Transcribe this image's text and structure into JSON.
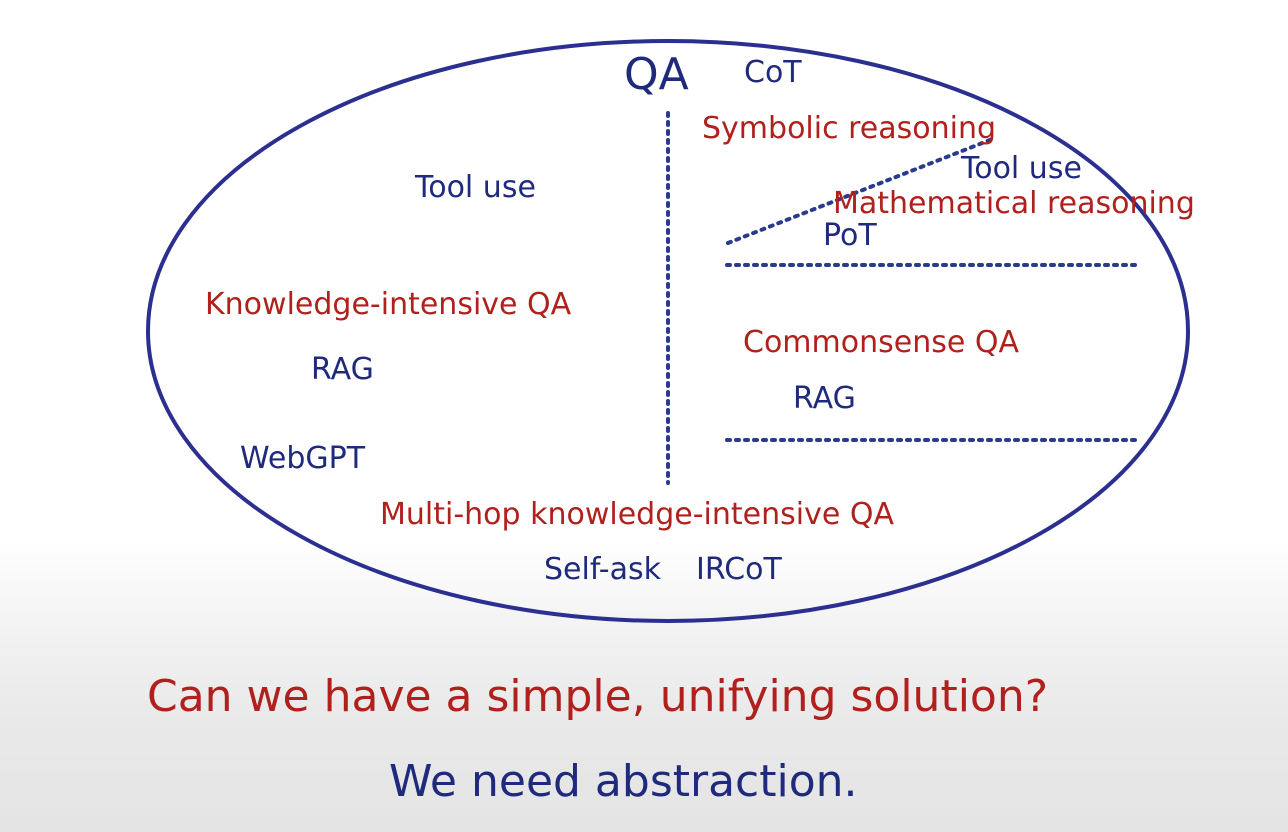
{
  "diagram": {
    "title": "QA",
    "left_region": {
      "tool_use": "Tool use",
      "knowledge_intensive": "Knowledge-intensive QA",
      "rag": "RAG",
      "webgpt": "WebGPT"
    },
    "right_region": {
      "cot": "CoT",
      "symbolic_reasoning": "Symbolic reasoning",
      "tool_use": "Tool use",
      "mathematical_reasoning": "Mathematical reasoning",
      "pot": "PoT",
      "commonsense_qa": "Commonsense QA",
      "rag": "RAG"
    },
    "bottom_region": {
      "multi_hop": "Multi-hop knowledge-intensive QA",
      "self_ask": "Self-ask",
      "ircot": "IRCoT"
    },
    "colors": {
      "blue": "#1f2a7c",
      "red": "#b0201c",
      "dotted_line": "#2a3b8f"
    }
  },
  "caption": {
    "question": "Can we have a simple, unifying solution?",
    "answer": "We need abstraction."
  }
}
